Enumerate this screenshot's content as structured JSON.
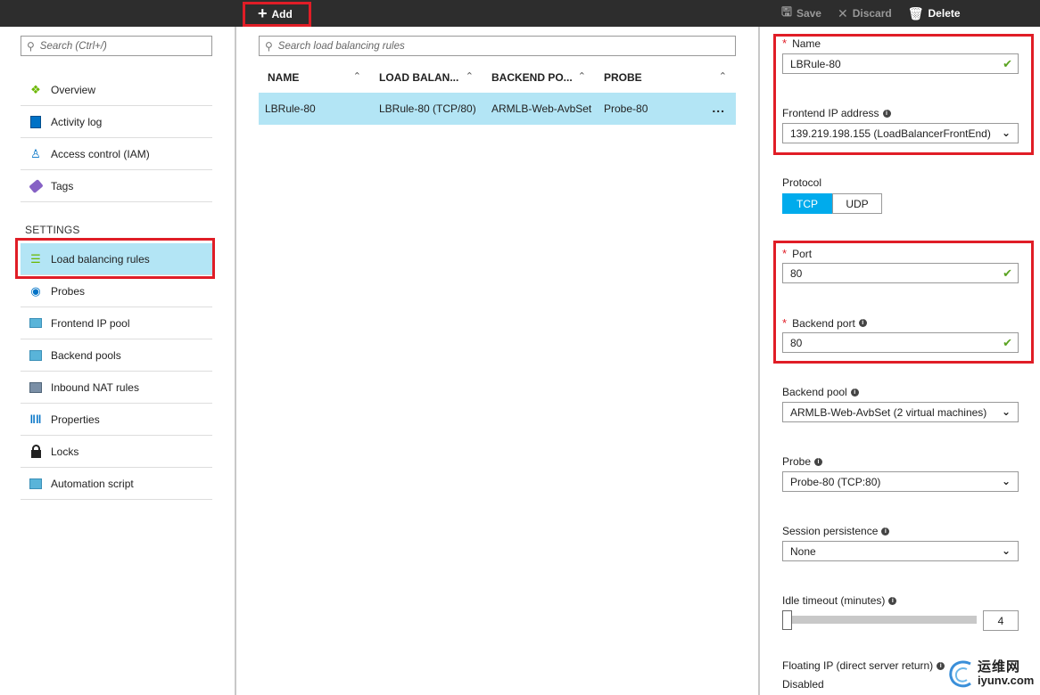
{
  "toolbar": {
    "add_label": "Add",
    "save_label": "Save",
    "discard_label": "Discard",
    "delete_label": "Delete"
  },
  "sidebar": {
    "search_placeholder": "Search (Ctrl+/)",
    "items": [
      {
        "label": "Overview",
        "icon": "overview-icon"
      },
      {
        "label": "Activity log",
        "icon": "activity-log-icon"
      },
      {
        "label": "Access control (IAM)",
        "icon": "users-icon"
      },
      {
        "label": "Tags",
        "icon": "tag-icon"
      }
    ],
    "settings_header": "SETTINGS",
    "settings_items": [
      {
        "label": "Load balancing rules",
        "icon": "list-icon"
      },
      {
        "label": "Probes",
        "icon": "probe-icon"
      },
      {
        "label": "Frontend IP pool",
        "icon": "ip-pool-icon"
      },
      {
        "label": "Backend pools",
        "icon": "backend-pool-icon"
      },
      {
        "label": "Inbound NAT rules",
        "icon": "nat-rules-icon"
      },
      {
        "label": "Properties",
        "icon": "properties-icon"
      },
      {
        "label": "Locks",
        "icon": "lock-icon"
      },
      {
        "label": "Automation script",
        "icon": "script-icon"
      }
    ]
  },
  "main": {
    "search_placeholder": "Search load balancing rules",
    "columns": [
      "NAME",
      "LOAD BALAN...",
      "BACKEND PO...",
      "PROBE"
    ],
    "rows": [
      {
        "name": "LBRule-80",
        "load_balancing": "LBRule-80 (TCP/80)",
        "backend_pool": "ARMLB-Web-AvbSet",
        "probe": "Probe-80",
        "more": "..."
      }
    ]
  },
  "form": {
    "name_label": "Name",
    "name_value": "LBRule-80",
    "frontend_ip_label": "Frontend IP address",
    "frontend_ip_value": "139.219.198.155 (LoadBalancerFrontEnd)",
    "protocol_label": "Protocol",
    "protocol_options": [
      "TCP",
      "UDP"
    ],
    "port_label": "Port",
    "port_value": "80",
    "backend_port_label": "Backend port",
    "backend_port_value": "80",
    "backend_pool_label": "Backend pool",
    "backend_pool_value": "ARMLB-Web-AvbSet (2 virtual machines)",
    "probe_label": "Probe",
    "probe_value": "Probe-80 (TCP:80)",
    "session_label": "Session persistence",
    "session_value": "None",
    "idle_label": "Idle timeout (minutes)",
    "idle_value": "4",
    "floating_label": "Floating IP (direct server return)",
    "floating_value": "Disabled"
  },
  "watermark": {
    "cn": "运维网",
    "en": "iyunv.com"
  },
  "colors": {
    "accent": "#00abec",
    "selection": "#b3e5f5",
    "highlight_frame": "#e01d26",
    "topbar": "#2d2d2d",
    "valid_check": "#5aa321"
  }
}
